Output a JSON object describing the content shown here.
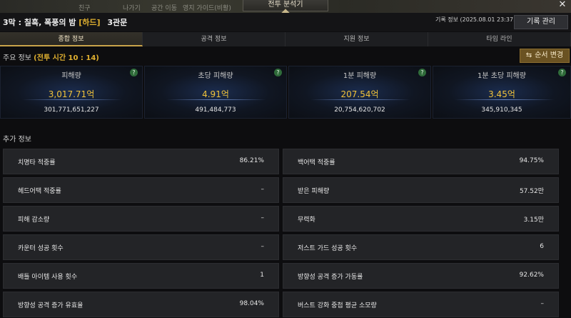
{
  "window": {
    "title": "전투 분석기",
    "close": "✕"
  },
  "background_tabs": [
    "친구",
    "나가기",
    "공간 이동",
    "영지 가이드(비활)"
  ],
  "header": {
    "stage_prefix": "3막 : 칠흑, 폭풍의 밤",
    "difficulty": "[하드]",
    "gate": "3관문",
    "record_info": "기록 정보 (2025.08.01 23:37:59)",
    "record_button": "기록 관리"
  },
  "tabs": [
    {
      "label": "종합 정보",
      "active": true
    },
    {
      "label": "공격 정보",
      "active": false
    },
    {
      "label": "지원 정보",
      "active": false
    },
    {
      "label": "타임 라인",
      "active": false
    }
  ],
  "main_info": {
    "label": "주요 정보",
    "combat_time": "(전투 시간 10 : 14)",
    "order_button": "순서 변경",
    "order_icon": "⇆"
  },
  "stats": [
    {
      "label": "피해량",
      "main": "3,017.71억",
      "sub": "301,771,651,227"
    },
    {
      "label": "초당 피해량",
      "main": "4.91억",
      "sub": "491,484,773"
    },
    {
      "label": "1분 피해량",
      "main": "207.54억",
      "sub": "20,754,620,702"
    },
    {
      "label": "1분 초당 피해량",
      "main": "3.45억",
      "sub": "345,910,345"
    }
  ],
  "help_icon": "?",
  "extra": {
    "label": "추가 정보",
    "rows": [
      {
        "label": "치명타 적중률",
        "value": "86.21%"
      },
      {
        "label": "백어택 적중률",
        "value": "94.75%"
      },
      {
        "label": "헤드어택 적중률",
        "value": "–"
      },
      {
        "label": "받은 피해량",
        "value": "57.52만"
      },
      {
        "label": "피해 감소량",
        "value": "–"
      },
      {
        "label": "무력화",
        "value": "3.15만"
      },
      {
        "label": "카운터 성공 횟수",
        "value": "–"
      },
      {
        "label": "저스트 가드 성공 횟수",
        "value": "6"
      },
      {
        "label": "배틀 아이템 사용 횟수",
        "value": "1"
      },
      {
        "label": "방향성 공격 증가 가동률",
        "value": "92.62%"
      },
      {
        "label": "방향성 공격 증가 유효율",
        "value": "98.04%"
      },
      {
        "label": "버스트 강화 중첩 평균 소모량",
        "value": "–"
      }
    ]
  },
  "colors": {
    "accent": "#e0b030",
    "stat_value": "#f0c23a",
    "order_button": "#6a5222",
    "help": "#2f6b3a"
  }
}
